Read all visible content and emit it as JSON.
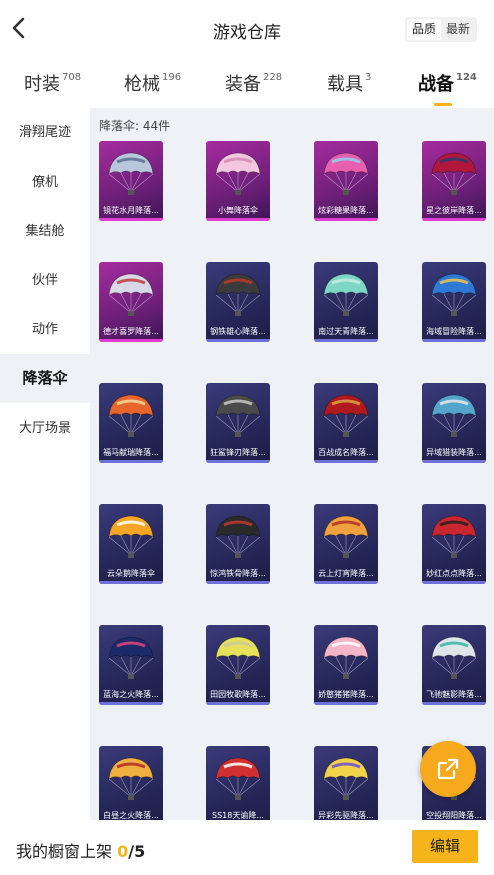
{
  "header": {
    "title": "游戏仓库",
    "sort": [
      "品质",
      "最新"
    ],
    "sort_active": 0
  },
  "tabs": [
    {
      "label": "时装",
      "count": "708"
    },
    {
      "label": "枪械",
      "count": "196"
    },
    {
      "label": "装备",
      "count": "228"
    },
    {
      "label": "载具",
      "count": "3"
    },
    {
      "label": "战备",
      "count": "124"
    }
  ],
  "active_tab": 4,
  "sidebar": [
    "滑翔尾迹",
    "僚机",
    "集结舱",
    "伙伴",
    "动作",
    "降落伞",
    "大厅场景"
  ],
  "active_sidebar": 5,
  "content": {
    "count_label": "降落伞: 44件"
  },
  "items": [
    {
      "name": "镜花水月降落...",
      "rarity": "legendary",
      "canopy": "#b8c8dc",
      "accent": "#5a6f93"
    },
    {
      "name": "小舞降落伞",
      "rarity": "legendary",
      "canopy": "#f2c7df",
      "accent": "#d488b6"
    },
    {
      "name": "炫彩糖果降落...",
      "rarity": "legendary",
      "canopy": "#e85fb0",
      "accent": "#8ad3f0"
    },
    {
      "name": "星之彼岸降落...",
      "rarity": "legendary",
      "canopy": "#b0173a",
      "accent": "#2c3a70"
    },
    {
      "name": "德才喜罗降落...",
      "rarity": "legendary",
      "canopy": "#d8d8e8",
      "accent": "#c23b3b"
    },
    {
      "name": "钢铁雄心降落...",
      "rarity": "epic",
      "canopy": "#3b3b3b",
      "accent": "#c0392b"
    },
    {
      "name": "南过天青降落...",
      "rarity": "epic",
      "canopy": "#7ed6c4",
      "accent": "#c9efe6"
    },
    {
      "name": "海域冒险降落...",
      "rarity": "epic",
      "canopy": "#2f79d6",
      "accent": "#f2c14e"
    },
    {
      "name": "福马献瑞降落...",
      "rarity": "epic",
      "canopy": "#e8652c",
      "accent": "#f7d9a0"
    },
    {
      "name": "狂鲨锋刃降落...",
      "rarity": "epic",
      "canopy": "#4a4a4a",
      "accent": "#c9c9c9"
    },
    {
      "name": "百战成名降落...",
      "rarity": "epic",
      "canopy": "#b0191d",
      "accent": "#d9a441"
    },
    {
      "name": "异域猎装降落...",
      "rarity": "epic",
      "canopy": "#53a6c9",
      "accent": "#e6e6e6"
    },
    {
      "name": "云朵鹅降落伞",
      "rarity": "epic",
      "canopy": "#f5a524",
      "accent": "#ffffff"
    },
    {
      "name": "惊鸿铁骨降落...",
      "rarity": "epic",
      "canopy": "#2a2a2a",
      "accent": "#c0392b"
    },
    {
      "name": "云上灯宵降落...",
      "rarity": "epic",
      "canopy": "#f0a03c",
      "accent": "#b0302a"
    },
    {
      "name": "妙红点点降落...",
      "rarity": "epic",
      "canopy": "#c9262d",
      "accent": "#222222"
    },
    {
      "name": "蓝海之火降落...",
      "rarity": "epic",
      "canopy": "#1d2a6a",
      "accent": "#e0447a"
    },
    {
      "name": "田园牧歌降落...",
      "rarity": "epic",
      "canopy": "#e6e05a",
      "accent": "#c9c9a0"
    },
    {
      "name": "娇憨猪猪降落...",
      "rarity": "epic",
      "canopy": "#f4b6c7",
      "accent": "#ffffff"
    },
    {
      "name": "飞驰魅影降落...",
      "rarity": "epic",
      "canopy": "#dfe6ea",
      "accent": "#39b5a3"
    },
    {
      "name": "白昼之火降落...",
      "rarity": "epic",
      "canopy": "#f0b040",
      "accent": "#b02a2a"
    },
    {
      "name": "SS18天谕降...",
      "rarity": "epic",
      "canopy": "#d03030",
      "accent": "#ffffff"
    },
    {
      "name": "异彩先驱降落...",
      "rarity": "epic",
      "canopy": "#f2d34a",
      "accent": "#6b4fd6"
    },
    {
      "name": "空投翔阳降落...",
      "rarity": "epic",
      "canopy": "#e86a2c",
      "accent": "#f5d36a"
    }
  ],
  "bottom": {
    "showcase_label": "我的橱窗上架",
    "showcase_current": "0",
    "showcase_max": "/5",
    "edit_label": "编辑"
  }
}
